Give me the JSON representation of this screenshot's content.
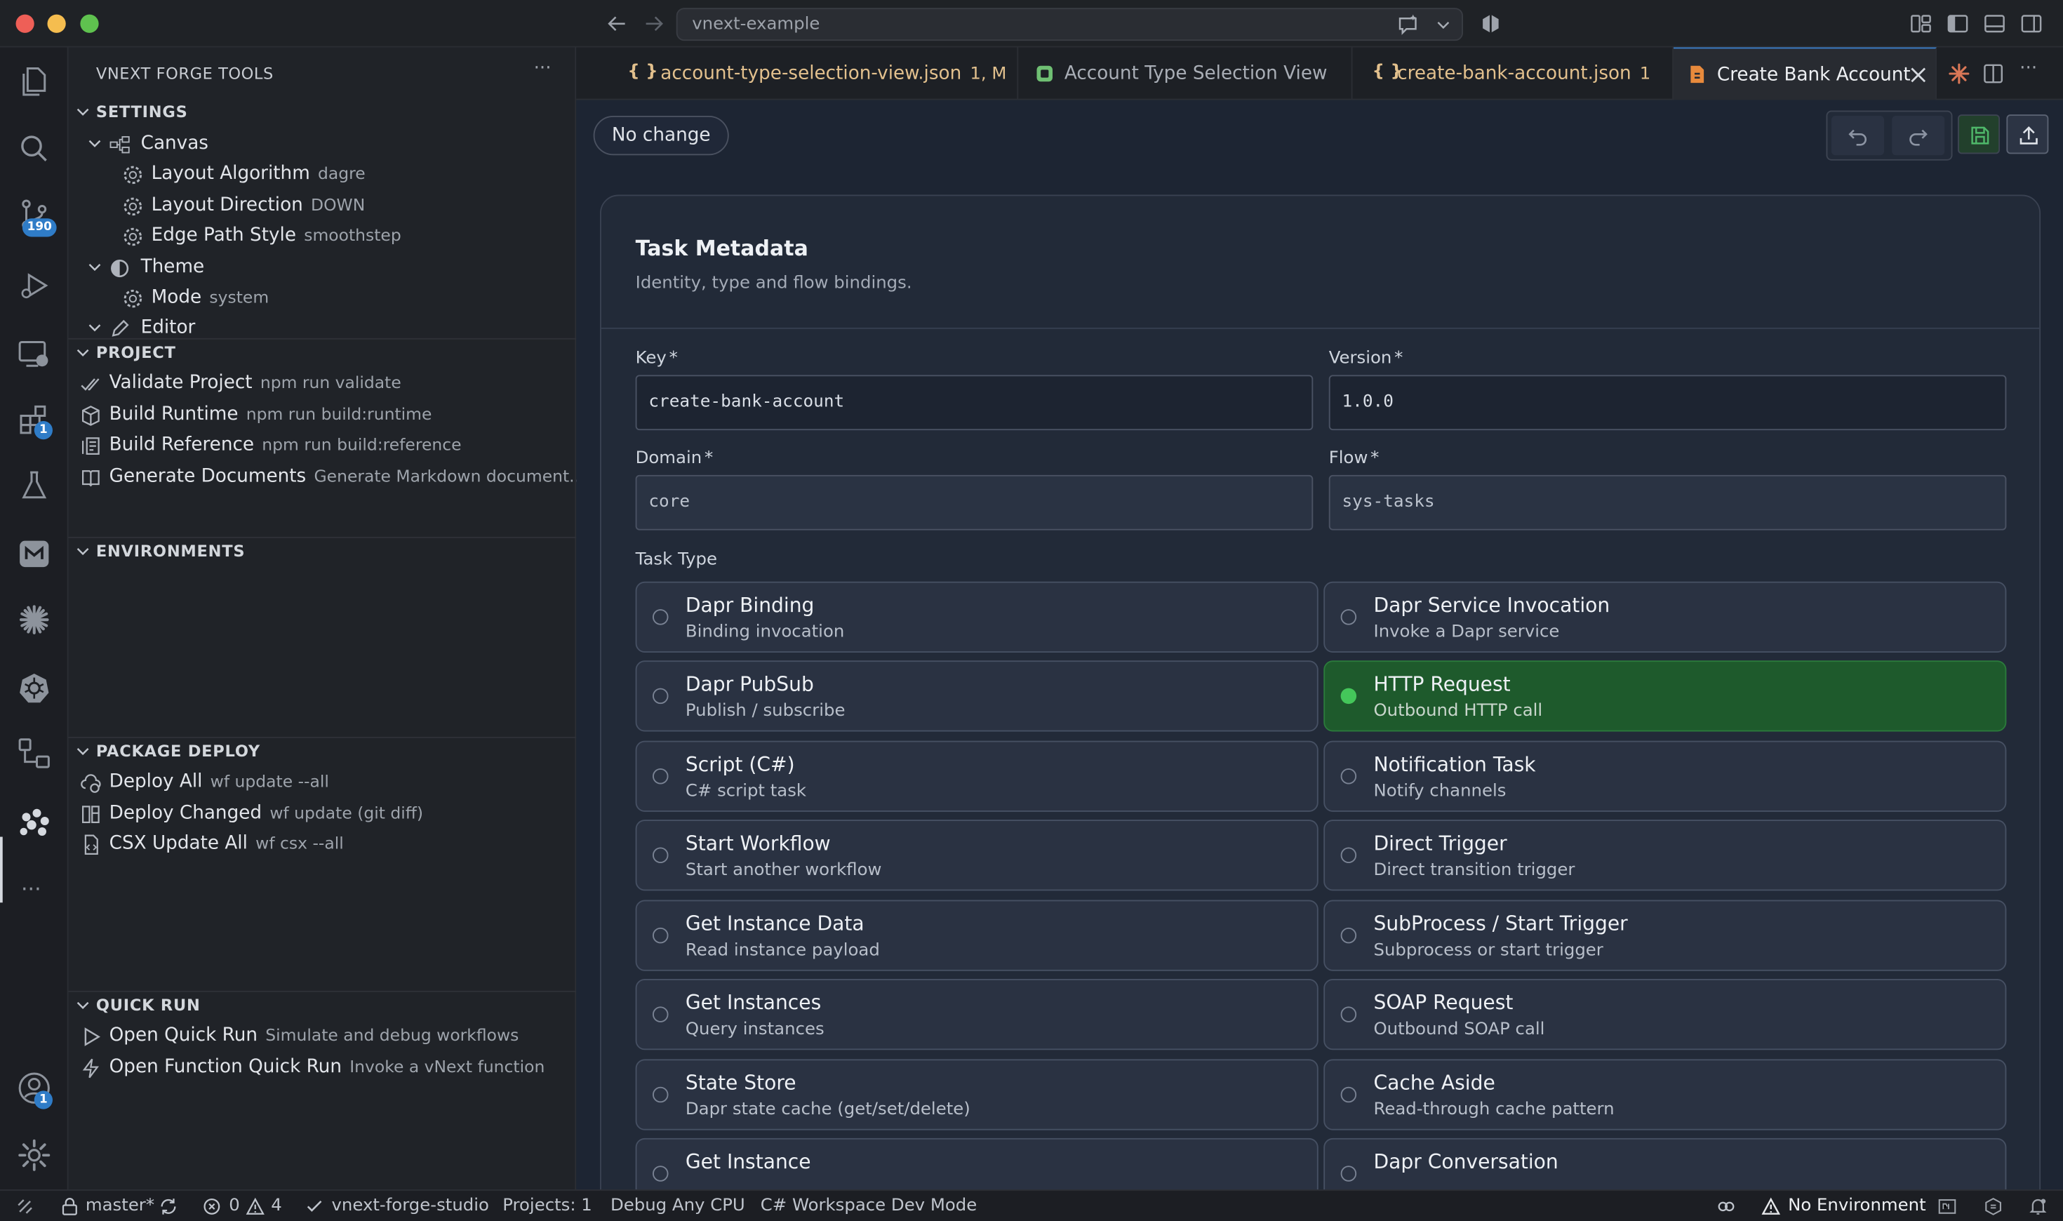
{
  "window": {
    "command_center": "vnext-example"
  },
  "activity_bar": {
    "source_control_badge": "190",
    "extensions_badge": "1",
    "accounts_badge": "1",
    "more": "···"
  },
  "sidebar": {
    "title": "VNEXT FORGE TOOLS",
    "more": "···",
    "settings": {
      "header": "SETTINGS",
      "canvas": "Canvas",
      "layout_algorithm": {
        "label": "Layout Algorithm",
        "value": "dagre"
      },
      "layout_direction": {
        "label": "Layout Direction",
        "value": "DOWN"
      },
      "edge_path_style": {
        "label": "Edge Path Style",
        "value": "smoothstep"
      },
      "theme": "Theme",
      "mode": {
        "label": "Mode",
        "value": "system"
      },
      "editor": "Editor"
    },
    "project": {
      "header": "PROJECT",
      "items": [
        {
          "label": "Validate Project",
          "desc": "npm run validate"
        },
        {
          "label": "Build Runtime",
          "desc": "npm run build:runtime"
        },
        {
          "label": "Build Reference",
          "desc": "npm run build:reference"
        },
        {
          "label": "Generate Documents",
          "desc": "Generate Markdown document..."
        }
      ]
    },
    "environments": {
      "header": "ENVIRONMENTS"
    },
    "package_deploy": {
      "header": "PACKAGE DEPLOY",
      "items": [
        {
          "label": "Deploy All",
          "desc": "wf update --all"
        },
        {
          "label": "Deploy Changed",
          "desc": "wf update (git diff)"
        },
        {
          "label": "CSX Update All",
          "desc": "wf csx --all"
        }
      ]
    },
    "quick_run": {
      "header": "QUICK RUN",
      "items": [
        {
          "label": "Open Quick Run",
          "desc": "Simulate and debug workflows"
        },
        {
          "label": "Open Function Quick Run",
          "desc": "Invoke a vNext function"
        }
      ]
    }
  },
  "tabs": [
    {
      "label": "account-type-selection-view.json",
      "status": "1, M"
    },
    {
      "label": "Account Type Selection View",
      "status": ""
    },
    {
      "label": "create-bank-account.json",
      "status": "1"
    },
    {
      "label": "Create Bank Account",
      "status": ""
    }
  ],
  "editor": {
    "status_pill": "No change",
    "card": {
      "title": "Task Metadata",
      "subtitle": "Identity, type and flow bindings.",
      "fields": {
        "key": {
          "label": "Key",
          "value": "create-bank-account"
        },
        "version": {
          "label": "Version",
          "value": "1.0.0"
        },
        "domain": {
          "label": "Domain",
          "value": "core"
        },
        "flow": {
          "label": "Flow",
          "value": "sys-tasks"
        }
      },
      "required_mark": "*",
      "task_type_label": "Task Type",
      "task_types": [
        {
          "title": "Dapr Binding",
          "sub": "Binding invocation"
        },
        {
          "title": "Dapr Service Invocation",
          "sub": "Invoke a Dapr service"
        },
        {
          "title": "Dapr PubSub",
          "sub": "Publish / subscribe"
        },
        {
          "title": "HTTP Request",
          "sub": "Outbound HTTP call",
          "selected": true
        },
        {
          "title": "Script (C#)",
          "sub": "C# script task"
        },
        {
          "title": "Notification Task",
          "sub": "Notify channels"
        },
        {
          "title": "Start Workflow",
          "sub": "Start another workflow"
        },
        {
          "title": "Direct Trigger",
          "sub": "Direct transition trigger"
        },
        {
          "title": "Get Instance Data",
          "sub": "Read instance payload"
        },
        {
          "title": "SubProcess / Start Trigger",
          "sub": "Subprocess or start trigger"
        },
        {
          "title": "Get Instances",
          "sub": "Query instances"
        },
        {
          "title": "SOAP Request",
          "sub": "Outbound SOAP call"
        },
        {
          "title": "State Store",
          "sub": "Dapr state cache (get/set/delete)"
        },
        {
          "title": "Cache Aside",
          "sub": "Read-through cache pattern"
        },
        {
          "title": "Get Instance",
          "sub": ""
        },
        {
          "title": "Dapr Conversation",
          "sub": ""
        }
      ]
    }
  },
  "status_bar": {
    "branch": "master*",
    "errors": "0",
    "warnings": "4",
    "workspace": "vnext-forge-studio",
    "projects": "Projects: 1",
    "debug": "Debug Any CPU",
    "mode": "C# Workspace Dev Mode",
    "environment": "No Environment"
  },
  "colors": {
    "selected_bg": "#1e5a2c",
    "selected_dot": "#44c75a",
    "json_file": "#e2c08d",
    "badge": "#2f7cc7"
  }
}
